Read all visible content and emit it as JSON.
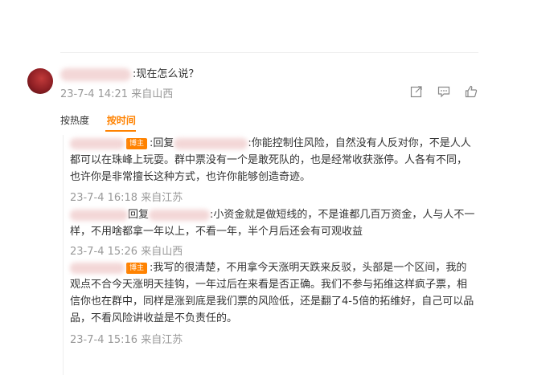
{
  "comment": {
    "text": ":现在怎么说？",
    "meta": "23-7-4 14:21 来自山西"
  },
  "actions": {
    "share_icon": "share-icon",
    "comment_icon": "comment-icon",
    "like_icon": "thumbs-up-icon"
  },
  "sort": {
    "by_hot": "按热度",
    "by_time": "按时间"
  },
  "replies": [
    {
      "badge": "博主",
      "prefix": ":回复",
      "text": ":你能控制住风险，自然没有人反对你，不是人人都可以在珠峰上玩耍。群中票没有一个是敢死队的，也是经常收获涨停。人各有不同，也许你是非常擅长这种方式，也许你能够创造奇迹。",
      "meta": "23-7-4 16:18 来自江苏"
    },
    {
      "prefix": "回复",
      "text": ":小资金就是做短线的，不是谁都几百万资金，人与人不一样，不用啥都拿一年以上，不看一年，半个月后还会有可观收益",
      "meta": "23-7-4 15:26 来自山西"
    },
    {
      "badge": "博主",
      "text": ":我写的很清楚，不用拿今天涨明天跌来反驳，头部是一个区间，我的观点不合今天涨明天挂钩，一年过后在来看是否正确。我们不参与拓维这样疯子票，相信你也在群中，同样是涨到底是我们票的风险低，还是翻了4-5倍的拓维好，自己可以品品，不看风险讲收益是不负责任的。",
      "meta": "23-7-4 15:16 来自江苏"
    }
  ],
  "colors": {
    "accent": "#ff8200",
    "meta_gray": "#999999",
    "text": "#333333"
  }
}
